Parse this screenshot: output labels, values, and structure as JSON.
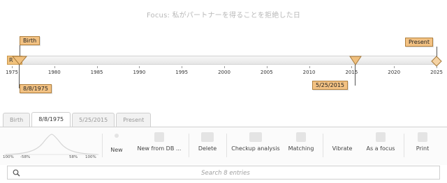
{
  "title": "Focus: 私がパートナーを得ることを拒絶した日",
  "timeline": {
    "start_badge": "R",
    "years": [
      "1975",
      "1980",
      "1985",
      "1990",
      "1995",
      "2000",
      "2005",
      "2010",
      "2015",
      "2020",
      "2025"
    ],
    "markers": {
      "birth": "Birth",
      "focus_date": "8/8/1975",
      "event_date": "5/25/2015",
      "present": "Present"
    }
  },
  "tabs": [
    {
      "label": "Birth"
    },
    {
      "label": "8/8/1975"
    },
    {
      "label": "5/25/2015"
    },
    {
      "label": "Present"
    }
  ],
  "distribution": {
    "labels": [
      "100%",
      "-58%",
      "58%",
      "100%"
    ]
  },
  "toolbar": {
    "new_label": "New",
    "new_from_db_label": "New from DB ...",
    "delete_label": "Delete",
    "checkup_label": "Checkup analysis",
    "matching_label": "Matching",
    "vibrate_label": "Vibrate",
    "focus_label": "As a focus",
    "print_label": "Print"
  },
  "search": {
    "placeholder": "Search 8 entries"
  }
}
